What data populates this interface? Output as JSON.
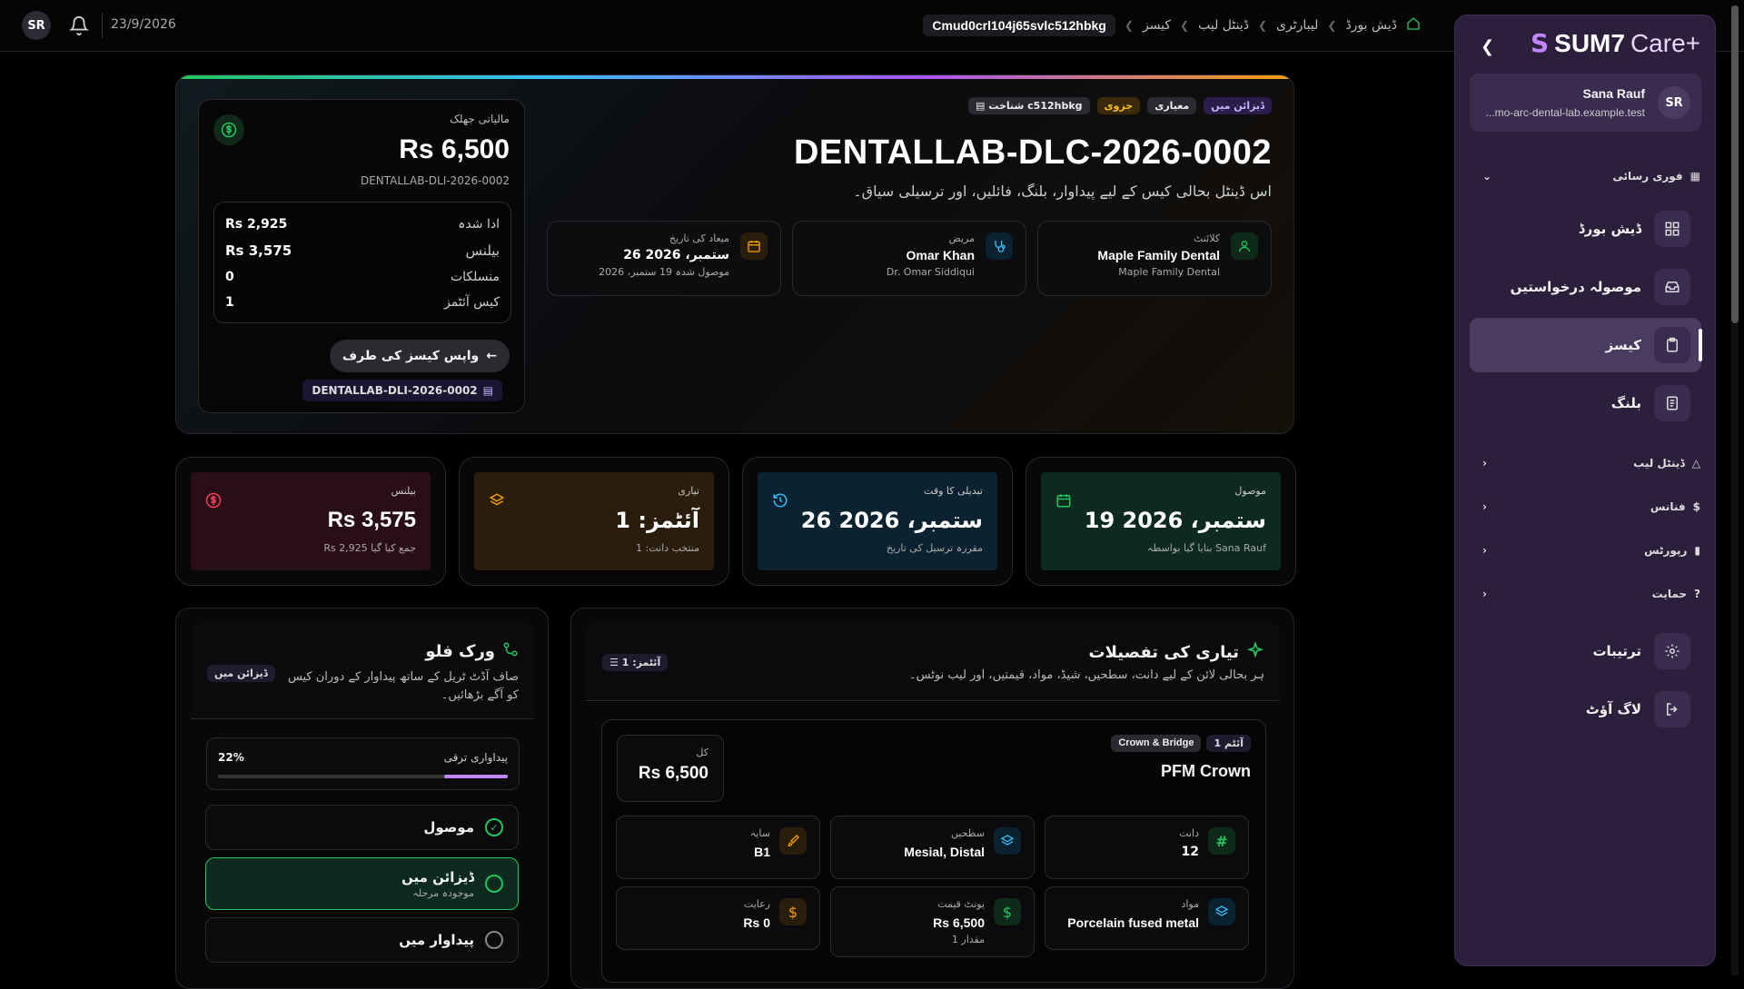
{
  "topbar": {
    "avatar": "SR",
    "date": "23/9/2026",
    "crumbs": [
      "ڈیش بورڈ",
      "لیبارٹری",
      "ڈینٹل لیب",
      "کیسز"
    ],
    "current": "Cmud0crl104j65svlc512hbkg"
  },
  "sidebar": {
    "brand": "SUM7",
    "brand_suffix": "Care+",
    "user_name": "Sana Rauf",
    "user_email": "...mo-arc-dental-lab.example.test",
    "user_avatar": "SR",
    "quick_access": "فوری رسائی",
    "items": [
      {
        "label": "ڈیش بورڈ",
        "icon": "dashboard-icon"
      },
      {
        "label": "موصولہ درخواستیں",
        "icon": "inbox-icon"
      },
      {
        "label": "کیسز",
        "icon": "clipboard-icon"
      },
      {
        "label": "بلنگ",
        "icon": "invoice-icon"
      }
    ],
    "groups": [
      {
        "label": "ڈینٹل لیب",
        "icon": "flask-icon"
      },
      {
        "label": "فنانس",
        "icon": "dollar-icon"
      },
      {
        "label": "رپورٹس",
        "icon": "chart-icon"
      },
      {
        "label": "حمایت",
        "icon": "help-icon"
      }
    ],
    "settings": "ترتیبات",
    "logout": "لاگ آؤٹ"
  },
  "hero": {
    "pills": [
      "ڈیزائن میں",
      "معیاری",
      "جزوی"
    ],
    "id_pill": "شناخت c512hbkg",
    "title": "DENTALLAB-DLC-2026-0002",
    "subtitle": "اس ڈینٹل بحالی کیس کے لیے پیداوار، بلنگ، فائلیں، اور ترسیلی سیاق۔",
    "info": [
      {
        "label": "کلائنٹ",
        "value": "Maple Family Dental",
        "sub": "Maple Family Dental",
        "icon": "user-icon",
        "color": "#22c55e"
      },
      {
        "label": "مریض",
        "value": "Omar Khan",
        "sub": "Dr. Omar Siddiqui",
        "icon": "stethoscope-icon",
        "color": "#22d3ee"
      },
      {
        "label": "میعاد کی تاریخ",
        "value": "26 ستمبر، 2026",
        "sub": "موصول شدہ 19 ستمبر، 2026",
        "icon": "calendar-clock-icon",
        "color": "#f59e0b"
      }
    ]
  },
  "finance": {
    "label": "مالیاتی جھلک",
    "amount": "Rs 6,500",
    "invoice": "DENTALLAB-DLI-2026-0002",
    "rows": [
      {
        "label": "ادا شدہ",
        "value": "Rs 2,925"
      },
      {
        "label": "بیلنس",
        "value": "Rs 3,575"
      },
      {
        "label": "منسلکات",
        "value": "0"
      },
      {
        "label": "کیس آئٹمز",
        "value": "1"
      }
    ],
    "back": "واپس کیسز کی طرف",
    "invoice_chip": "DENTALLAB-DLI-2026-0002"
  },
  "stats": [
    {
      "label": "موصول",
      "value": "19 ستمبر، 2026",
      "sub": "بنایا گیا بواسطہ Sana Rauf",
      "icon": "calendar-icon",
      "bg": "#0c2a1d",
      "color": "#22c55e"
    },
    {
      "label": "تبدیلی کا وقت",
      "value": "26 ستمبر، 2026",
      "sub": "مقررہ ترسیل کی تاریخ",
      "icon": "history-icon",
      "bg": "#0b2230",
      "color": "#38bdf8"
    },
    {
      "label": "تیاری",
      "value": "آئٹمز: 1",
      "sub": "منتخب دانت: 1",
      "icon": "layers-icon",
      "bg": "#2a1d0b",
      "color": "#f59e0b"
    },
    {
      "label": "بیلنس",
      "value": "Rs 3,575",
      "sub": "Rs 2,925 جمع کیا گیا",
      "icon": "dollar-circle-icon",
      "bg": "#2a0e16",
      "color": "#f43f5e"
    }
  ],
  "workflow": {
    "title": "ورک فلو",
    "desc": "صاف آڈٹ ٹریل کے ساتھ پیداوار کے دوران کیس کو آگے بڑھائیں۔",
    "badge": "ڈیزائن میں",
    "progress_label": "پیداواری ترقی",
    "progress_text": "22%",
    "progress": 0.22,
    "steps": [
      {
        "label": "موصول",
        "sub": "",
        "state": "done"
      },
      {
        "label": "ڈیزائن میں",
        "sub": "موجودہ مرحلہ",
        "state": "current"
      },
      {
        "label": "پیداوار میں",
        "sub": "",
        "state": "pending"
      }
    ]
  },
  "prep": {
    "title": "تیاری کی تفصیلات",
    "desc": "ہر بحالی لائن کے لیے دانت، سطحیں، شیڈ، مواد، قیمتیں، اور لیب نوٹس۔",
    "badge": "آئٹمز: 1",
    "item": {
      "tag1": "آئٹم 1",
      "tag2": "Crown & Bridge",
      "name": "PFM Crown",
      "total_label": "کل",
      "total": "Rs 6,500",
      "fields": [
        {
          "label": "دانت",
          "value": "12",
          "sub": "",
          "icon": "hash-icon",
          "color": "#22c55e"
        },
        {
          "label": "سطحیں",
          "value": "Mesial, Distal",
          "sub": "",
          "icon": "layers-icon",
          "color": "#38bdf8"
        },
        {
          "label": "سایہ",
          "value": "B1",
          "sub": "",
          "icon": "brush-icon",
          "color": "#f59e0b"
        },
        {
          "label": "مواد",
          "value": "Porcelain fused metal",
          "sub": "",
          "icon": "layers-icon",
          "color": "#38bdf8"
        },
        {
          "label": "یونٹ قیمت",
          "value": "Rs 6,500",
          "sub": "مقدار 1",
          "icon": "dollar-circle-icon",
          "color": "#22c55e"
        },
        {
          "label": "رعایت",
          "value": "Rs 0",
          "sub": "",
          "icon": "dollar-circle-icon",
          "color": "#f59e0b"
        }
      ]
    }
  }
}
